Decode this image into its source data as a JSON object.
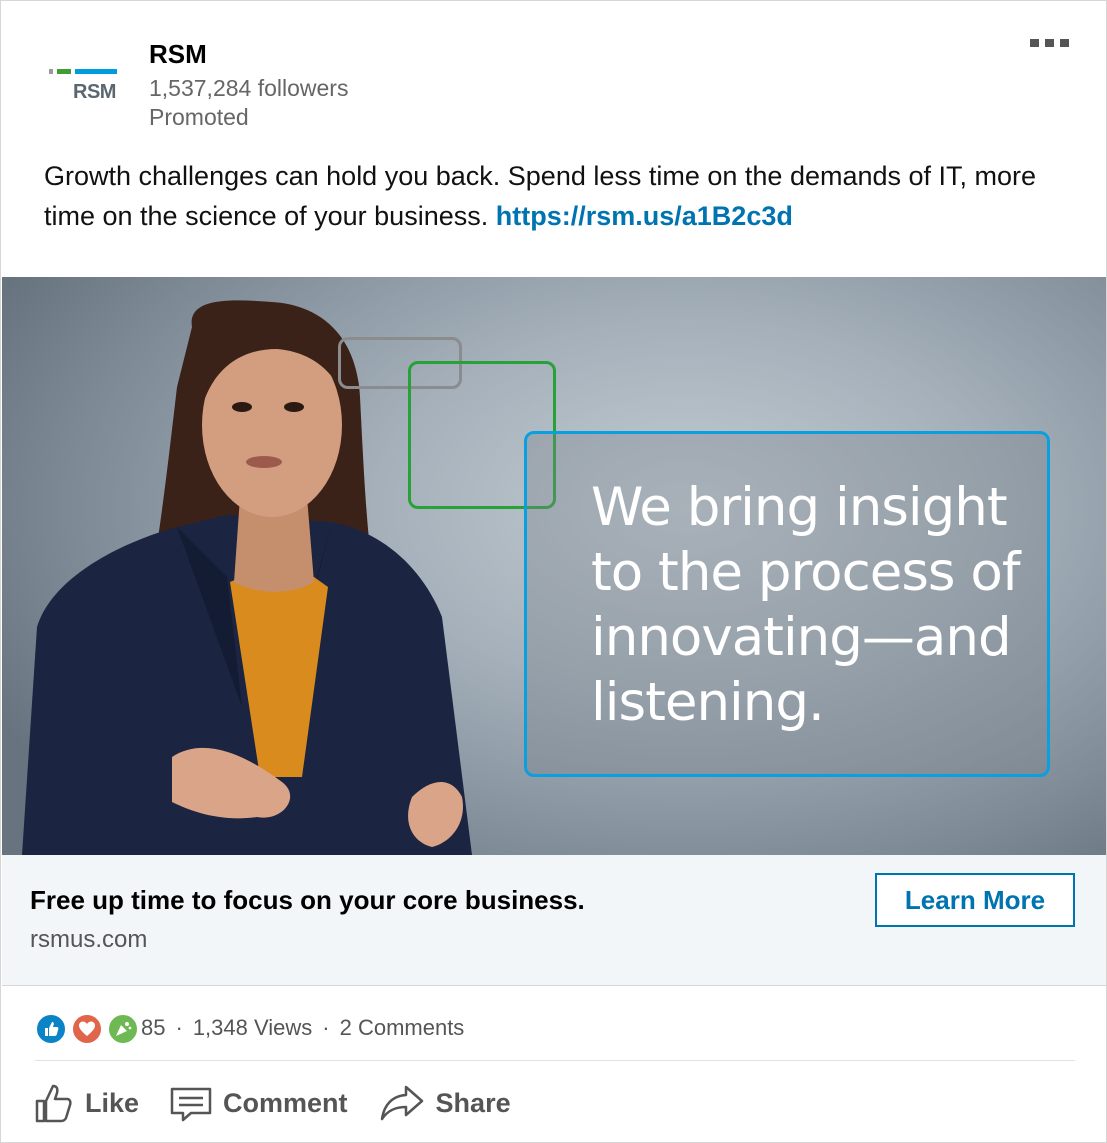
{
  "post": {
    "company": "RSM",
    "logo_text": "RSM",
    "followers": "1,537,284 followers",
    "promoted": "Promoted",
    "text": "Growth challenges can hold you back. Spend less time on the demands of IT, more time on the science of your business. ",
    "link": "https://rsm.us/a1B2c3d"
  },
  "hero": {
    "quote": "We bring insight to the process of innovating—and listening.",
    "frame_colors": {
      "gray": "#8a8c8e",
      "green": "#27a138",
      "blue": "#0aa0e0"
    }
  },
  "cta": {
    "headline": "Free up time to focus on your core business.",
    "domain": "rsmus.com",
    "button_label": "Learn More"
  },
  "social": {
    "reactions": [
      "like",
      "love",
      "celebrate"
    ],
    "reaction_count": "85",
    "views": "1,348 Views",
    "comments": "2 Comments",
    "separator": "·"
  },
  "actions": {
    "like_label": "Like",
    "comment_label": "Comment",
    "share_label": "Share"
  },
  "colors": {
    "accent": "#0073b1",
    "cta_background": "#f3f6f8"
  }
}
